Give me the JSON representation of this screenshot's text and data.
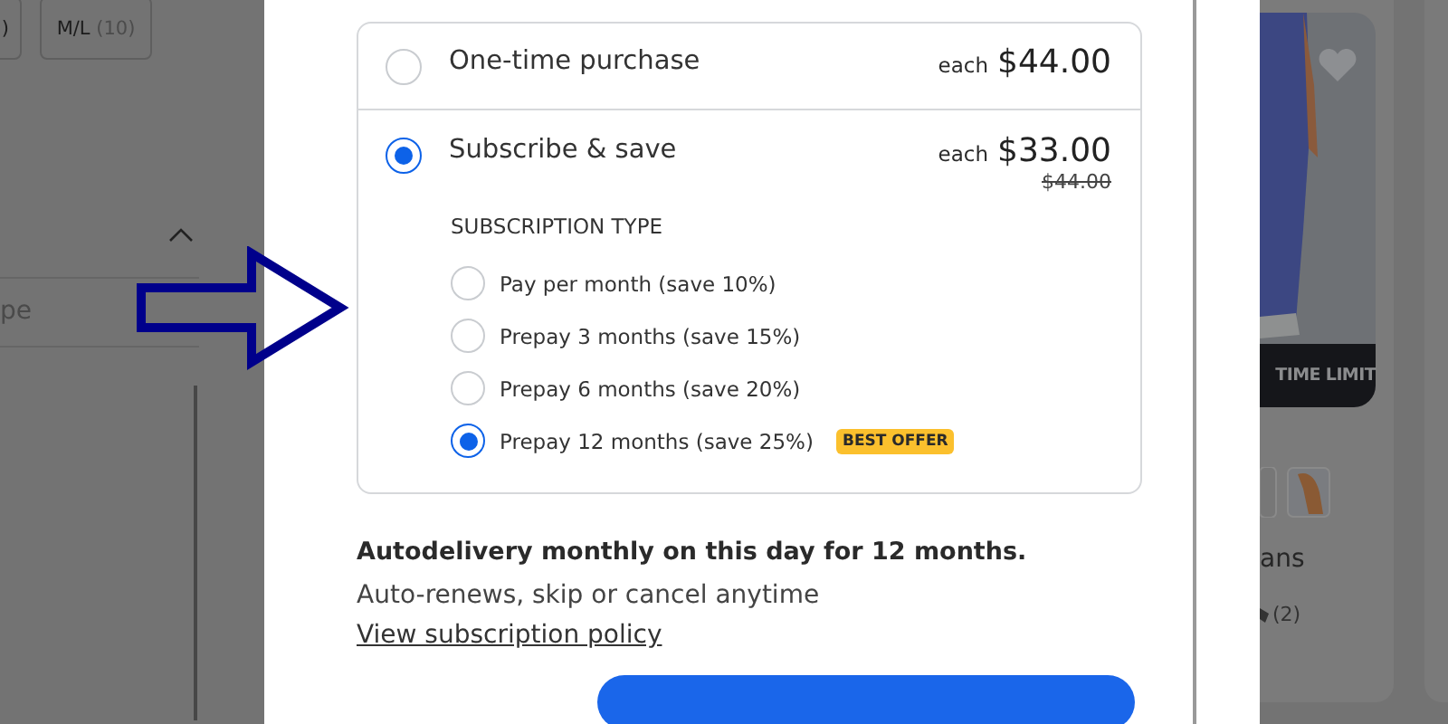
{
  "background_left": {
    "size_chips": [
      {
        "label": ")"
      },
      {
        "label": "M/L",
        "count": "(10)"
      }
    ],
    "filter_field": {
      "placeholder": "pe"
    }
  },
  "purchase_options": [
    {
      "kind": "one_time",
      "label": "One-time purchase",
      "price_prefix": "each",
      "price": "$44.00",
      "selected": false
    },
    {
      "kind": "subscribe",
      "label": "Subscribe & save",
      "price_prefix": "each",
      "price": "$33.00",
      "original_price": "$44.00",
      "selected": true,
      "subscription_type": {
        "heading": "SUBSCRIPTION TYPE",
        "options": [
          {
            "label": "Pay per month (save 10%)",
            "selected": false
          },
          {
            "label": "Prepay 3 months (save 15%)",
            "selected": false
          },
          {
            "label": "Prepay 6 months (save 20%)",
            "selected": false
          },
          {
            "label": "Prepay 12 months (save 25%)",
            "selected": true,
            "badge": "BEST OFFER"
          }
        ]
      }
    }
  ],
  "delivery_note": "Autodelivery monthly on this day for 12 months.",
  "renewal_note": "Auto-renews, skip or cancel anytime",
  "policy_link": "View subscription policy",
  "product_card": {
    "banner": "TIME LIMIT",
    "name": "ans",
    "review_count": "(2)"
  }
}
